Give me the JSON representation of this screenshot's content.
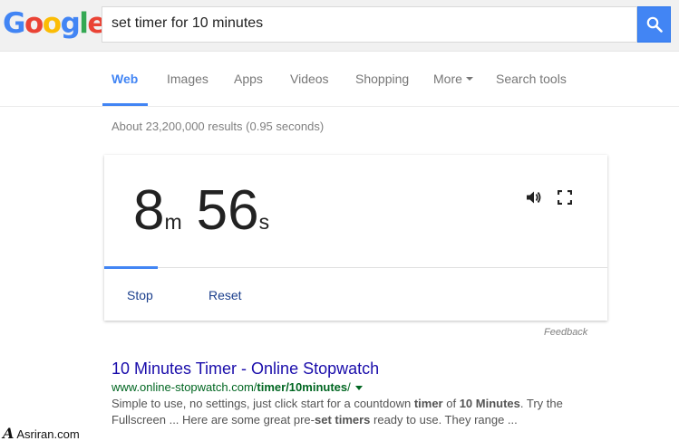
{
  "header": {
    "logo_letters": [
      "G",
      "o",
      "o",
      "g",
      "l",
      "e"
    ],
    "logo_colors": [
      "#4285f4",
      "#ea4335",
      "#fbbc05",
      "#4285f4",
      "#34a853",
      "#ea4335"
    ],
    "search_query": "set timer for 10 minutes",
    "search_button_icon": "search-icon"
  },
  "nav": {
    "tabs": [
      {
        "label": "Web",
        "active": true
      },
      {
        "label": "Images"
      },
      {
        "label": "Apps"
      },
      {
        "label": "Videos"
      },
      {
        "label": "Shopping"
      },
      {
        "label": "More"
      },
      {
        "label": "Search tools"
      }
    ],
    "accent_color": "#4285f4"
  },
  "result_stats": "About 23,200,000 results (0.95 seconds)",
  "timer": {
    "minutes": "8",
    "minutes_unit": "m",
    "seconds": "56",
    "seconds_unit": "s",
    "progress_fraction": 0.107,
    "sound_icon": "volume-icon",
    "fullscreen_icon": "fullscreen-icon",
    "stop_label": "Stop",
    "reset_label": "Reset"
  },
  "feedback_label": "Feedback",
  "result": {
    "title": "10 Minutes Timer - Online Stopwatch",
    "url_prefix": "www.online-stopwatch.com/",
    "url_bold": "timer/10minutes",
    "url_suffix": "/",
    "snippet": [
      {
        "t": "Simple to use, no settings, just click start for a countdown ",
        "b": false
      },
      {
        "t": "timer",
        "b": true
      },
      {
        "t": " of ",
        "b": false
      },
      {
        "t": "10 Minutes",
        "b": true
      },
      {
        "t": ". Try the Fullscreen ... Here are some great pre-",
        "b": false
      },
      {
        "t": "set timers",
        "b": true
      },
      {
        "t": " ready to use. They range ...",
        "b": false
      }
    ]
  },
  "watermark": {
    "mark": "A",
    "text": "Asriran.com"
  }
}
